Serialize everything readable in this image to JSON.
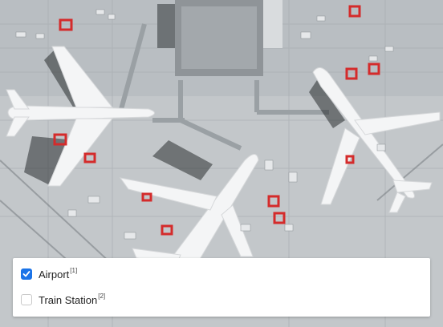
{
  "legend": {
    "items": [
      {
        "label": "Airport",
        "ref": "[1]",
        "checked": true
      },
      {
        "label": "Train Station",
        "ref": "[2]",
        "checked": false
      }
    ]
  },
  "colors": {
    "checkbox_checked": "#1a73e8",
    "marker_red": "#d42b2b"
  },
  "icons": [
    "check-icon",
    "airplane-icon"
  ]
}
